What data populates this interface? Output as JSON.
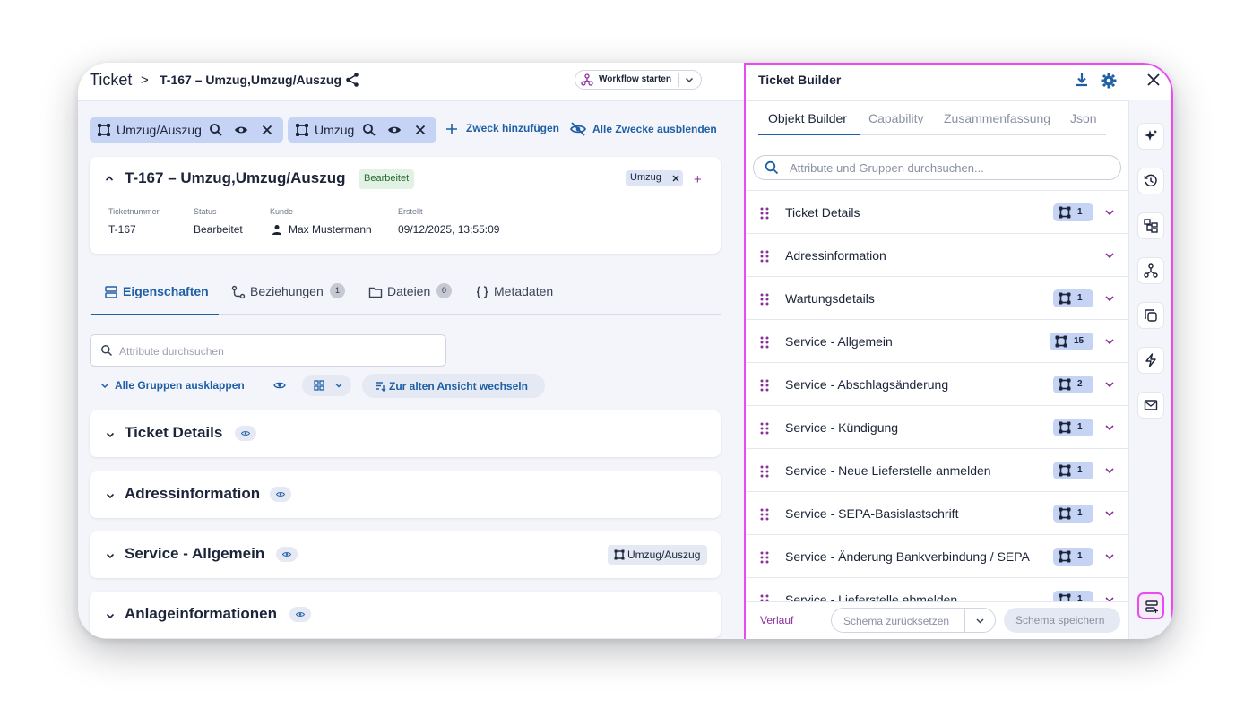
{
  "header": {
    "root": "Ticket",
    "separator": ">",
    "current": "T-167 – Umzug,Umzug/Auszug",
    "workflow_button": "Workflow starten"
  },
  "purposes": {
    "chips": [
      {
        "label": "Umzug/Auszug"
      },
      {
        "label": "Umzug"
      }
    ],
    "add_label": "Zweck hinzufügen",
    "hide_all_label": "Alle Zwecke ausblenden"
  },
  "ticket": {
    "title": "T-167 – Umzug,Umzug/Auszug",
    "status_badge": "Bearbeitet",
    "tag": "Umzug",
    "add": "+",
    "meta": [
      {
        "label": "Ticketnummer",
        "value": "T-167"
      },
      {
        "label": "Status",
        "value": "Bearbeitet"
      },
      {
        "label": "Kunde",
        "value": "Max Mustermann"
      },
      {
        "label": "Erstellt",
        "value": "09/12/2025, 13:55:09"
      }
    ]
  },
  "tabs": [
    {
      "label": "Eigenschaften",
      "active": true
    },
    {
      "label": "Beziehungen",
      "badge": "1"
    },
    {
      "label": "Dateien",
      "badge": "0"
    },
    {
      "label": "Metadaten"
    }
  ],
  "toolbar": {
    "search_placeholder": "Attribute durchsuchen",
    "expand_all": "Alle Gruppen ausklappen",
    "old_view": "Zur alten Ansicht wechseln"
  },
  "groups": [
    {
      "title": "Ticket Details"
    },
    {
      "title": "Adressinformation"
    },
    {
      "title": "Service - Allgemein",
      "tag": "Umzug/Auszug"
    },
    {
      "title": "Anlageinformationen"
    }
  ],
  "builder": {
    "title": "Ticket Builder",
    "tabs": [
      {
        "label": "Objekt Builder",
        "active": true
      },
      {
        "label": "Capability"
      },
      {
        "label": "Zusammenfassung"
      },
      {
        "label": "Json"
      }
    ],
    "search_placeholder": "Attribute und Gruppen durchsuchen...",
    "items": [
      {
        "label": "Ticket Details",
        "count": "1"
      },
      {
        "label": "Adressinformation",
        "count": null
      },
      {
        "label": "Wartungsdetails",
        "count": "1"
      },
      {
        "label": "Service - Allgemein",
        "count": "15"
      },
      {
        "label": "Service - Abschlagsänderung",
        "count": "2"
      },
      {
        "label": "Service - Kündigung",
        "count": "1"
      },
      {
        "label": "Service - Neue Lieferstelle anmelden",
        "count": "1"
      },
      {
        "label": "Service - SEPA-Basislastschrift",
        "count": "1"
      },
      {
        "label": "Service - Änderung Bankverbindung / SEPA",
        "count": "1"
      },
      {
        "label": "Service - Lieferstelle abmelden",
        "count": "1"
      }
    ],
    "footer": {
      "history": "Verlauf",
      "reset": "Schema zurücksetzen",
      "save": "Schema speichern"
    },
    "rail_icons": [
      "sparkle-icon",
      "history-icon",
      "hierarchy-icon",
      "workflow-icon",
      "copy-icon",
      "lightning-icon",
      "mail-icon",
      "schema-icon"
    ]
  },
  "colors": {
    "accent": "#1f5fa5",
    "highlight": "#e84cf0",
    "chip": "#c5d3f4"
  }
}
